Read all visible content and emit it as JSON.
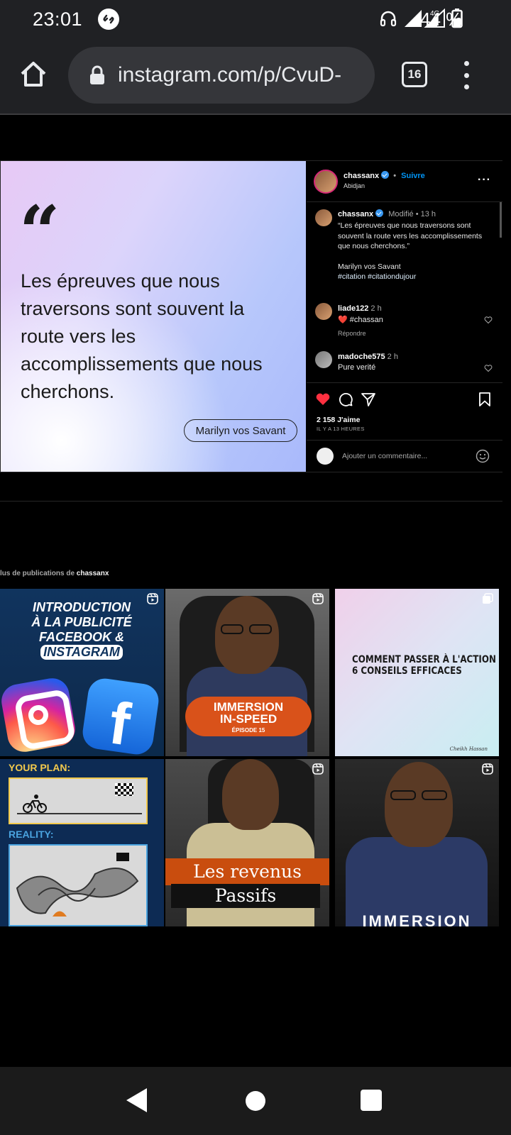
{
  "status_bar": {
    "time": "23:01",
    "network": "4G",
    "battery": "44 %",
    "icons": [
      "shazam-icon",
      "headphones-icon",
      "signal-icon",
      "battery-icon"
    ]
  },
  "browser": {
    "url": "instagram.com/p/CvuD-",
    "tab_count": "16",
    "icons": [
      "home-icon",
      "lock-icon",
      "tabs-icon",
      "more-vert-icon"
    ]
  },
  "post": {
    "image": {
      "quote_mark": "“",
      "quote_text": "Les épreuves que nous traversons sont souvent la route vers les accomplissements que nous cherchons.",
      "author": "Marilyn vos Savant"
    },
    "header": {
      "username": "chassanx",
      "separator": "•",
      "follow_label": "Suivre",
      "location": "Abidjan",
      "more": "···"
    },
    "caption": {
      "username": "chassanx",
      "meta": "Modifié • 13 h",
      "text": "“Les épreuves que nous traversons sont souvent la route vers les accomplissements que nous cherchons.”",
      "author_line": "Marilyn vos Savant",
      "hashtags": "#citation #citationdujour"
    },
    "comments": [
      {
        "username": "liade122",
        "time": "2 h",
        "text": "❤️ #chassan",
        "reply_label": "Répondre"
      },
      {
        "username": "madoche575",
        "time": "2 h",
        "text": "Pure verité"
      }
    ],
    "likes": "2 158 J'aime",
    "time_ago": "IL Y A 13 HEURES",
    "add_comment_placeholder": "Ajouter un commentaire..."
  },
  "more_section": {
    "prefix": "lus de publications de ",
    "username": "chassanx"
  },
  "grid": {
    "tile1": {
      "line1": "INTRODUCTION",
      "line2": "À LA PUBLICITÉ",
      "line3a": "FACEBOOK & ",
      "line3b": "INSTAGRAM"
    },
    "tile2": {
      "title1": "IMMERSION",
      "title2": "IN-SPEED",
      "episode": "ÉPISODE 15"
    },
    "tile3": {
      "title1": "COMMENT PASSER À L'ACTION ?",
      "title2": "6 CONSEILS EFFICACES",
      "signature": "Cheikh Hassan"
    },
    "tile4": {
      "label1": "YOUR PLAN:",
      "label2": "REALITY:"
    },
    "tile5": {
      "line1": "Les revenus",
      "line2": "Passifs"
    },
    "tile6": {
      "title": "IMMERSION"
    }
  },
  "colors": {
    "follow": "#0095f6",
    "like": "#ff3040",
    "verified": "#3897f0"
  }
}
